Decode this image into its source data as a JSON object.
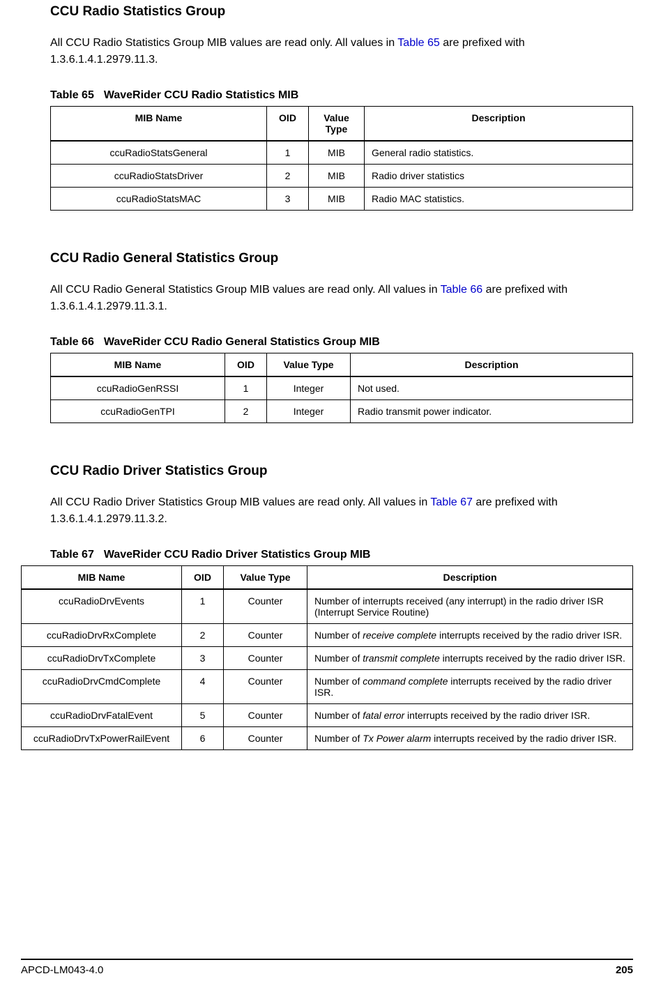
{
  "section1": {
    "heading": "CCU Radio Statistics Group",
    "body_pre": "All CCU Radio Statistics Group MIB values are read only. All values in ",
    "body_link": "Table 65",
    "body_post": " are prefixed with 1.3.6.1.4.1.2979.11.3.",
    "table": {
      "caption_num": "Table 65",
      "caption_title": "WaveRider CCU Radio Statistics MIB",
      "headers": {
        "name": "MIB Name",
        "oid": "OID",
        "vtype": "Value Type",
        "desc": "Description"
      },
      "rows": [
        {
          "name": "ccuRadioStatsGeneral",
          "oid": "1",
          "vtype": "MIB",
          "desc": "General radio statistics."
        },
        {
          "name": "ccuRadioStatsDriver",
          "oid": "2",
          "vtype": "MIB",
          "desc": "Radio driver statistics"
        },
        {
          "name": "ccuRadioStatsMAC",
          "oid": "3",
          "vtype": "MIB",
          "desc": "Radio MAC statistics."
        }
      ]
    }
  },
  "section2": {
    "heading": "CCU Radio General Statistics Group",
    "body_pre": "All CCU Radio General Statistics Group MIB values are read only. All values in ",
    "body_link": "Table 66",
    "body_post": " are prefixed with 1.3.6.1.4.1.2979.11.3.1.",
    "table": {
      "caption_num": "Table 66",
      "caption_title": "WaveRider CCU Radio General Statistics Group MIB",
      "headers": {
        "name": "MIB Name",
        "oid": "OID",
        "vtype": "Value Type",
        "desc": "Description"
      },
      "rows": [
        {
          "name": "ccuRadioGenRSSI",
          "oid": "1",
          "vtype": "Integer",
          "desc": "Not used."
        },
        {
          "name": "ccuRadioGenTPI",
          "oid": "2",
          "vtype": "Integer",
          "desc": "Radio transmit power indicator."
        }
      ]
    }
  },
  "section3": {
    "heading": "CCU Radio Driver Statistics Group",
    "body_pre": "All CCU Radio Driver Statistics Group MIB values are read only. All values in ",
    "body_link": "Table 67",
    "body_post": " are prefixed with 1.3.6.1.4.1.2979.11.3.2.",
    "table": {
      "caption_num": "Table 67",
      "caption_title": "WaveRider CCU Radio Driver Statistics Group MIB",
      "headers": {
        "name": "MIB Name",
        "oid": "OID",
        "vtype": "Value Type",
        "desc": "Description"
      },
      "rows": [
        {
          "name": "ccuRadioDrvEvents",
          "oid": "1",
          "vtype": "Counter",
          "desc_pre": "Number of interrupts received (any interrupt) in the radio driver ISR (Interrupt Service Routine)"
        },
        {
          "name": "ccuRadioDrvRxComplete",
          "oid": "2",
          "vtype": "Counter",
          "desc_pre": "Number of ",
          "desc_em": "receive complete",
          "desc_post": " interrupts received by the radio driver ISR."
        },
        {
          "name": "ccuRadioDrvTxComplete",
          "oid": "3",
          "vtype": "Counter",
          "desc_pre": "Number of ",
          "desc_em": "transmit complete",
          "desc_post": " interrupts received by the radio driver ISR."
        },
        {
          "name": "ccuRadioDrvCmdComplete",
          "oid": "4",
          "vtype": "Counter",
          "desc_pre": "Number of ",
          "desc_em": "command complete",
          "desc_post": " interrupts received by the radio driver ISR."
        },
        {
          "name": "ccuRadioDrvFatalEvent",
          "oid": "5",
          "vtype": "Counter",
          "desc_pre": "Number of ",
          "desc_em": "fatal error",
          "desc_post": " interrupts received by the radio driver ISR."
        },
        {
          "name": "ccuRadioDrvTxPowerRailEvent",
          "oid": "6",
          "vtype": "Counter",
          "desc_pre": "Number of ",
          "desc_em": "Tx Power alarm",
          "desc_post": " interrupts received by the radio driver ISR."
        }
      ]
    }
  },
  "footer": {
    "left": "APCD-LM043-4.0",
    "right": "205"
  }
}
